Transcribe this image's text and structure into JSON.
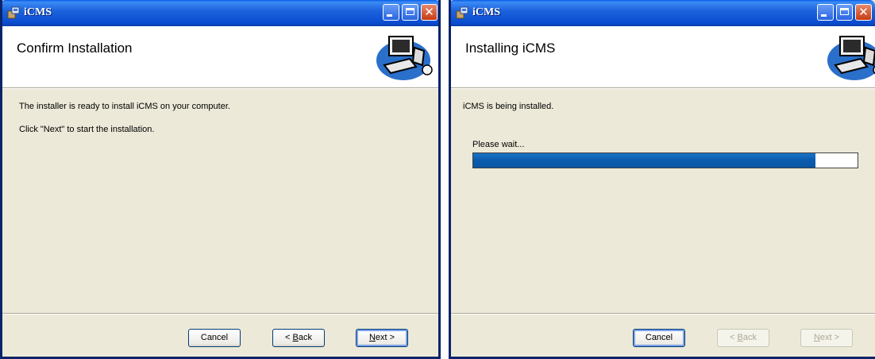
{
  "windows": [
    {
      "title": "iCMS",
      "banner_title": "Confirm Installation",
      "body_lines": [
        "The installer is ready to install iCMS on your computer.",
        "Click \"Next\" to start the installation."
      ],
      "buttons": {
        "cancel": "Cancel",
        "back": {
          "prefix": "< ",
          "accel": "B",
          "rest": "ack"
        },
        "next": {
          "accel": "N",
          "rest": "ext >"
        }
      },
      "button_states": {
        "cancel": "enabled",
        "back": "enabled",
        "next": "default"
      }
    },
    {
      "title": "iCMS",
      "banner_title": "Installing iCMS",
      "status_text": "iCMS is being installed.",
      "progress_label": "Please wait...",
      "progress_fraction": 0.89,
      "buttons": {
        "cancel": "Cancel",
        "back": {
          "prefix": "< ",
          "accel": "B",
          "rest": "ack"
        },
        "next": {
          "accel": "N",
          "rest": "ext >"
        }
      },
      "button_states": {
        "cancel": "default",
        "back": "disabled",
        "next": "disabled"
      }
    }
  ],
  "colors": {
    "titlebar": "#0a4cd0",
    "window_face": "#ece9d8",
    "banner": "#ffffff",
    "progress_fill": "#0b5bac"
  },
  "icons": {
    "app": "installer-package-icon",
    "banner": "computer-setup-icon",
    "minimize": "minimize-icon",
    "maximize": "maximize-icon",
    "close": "close-icon"
  }
}
